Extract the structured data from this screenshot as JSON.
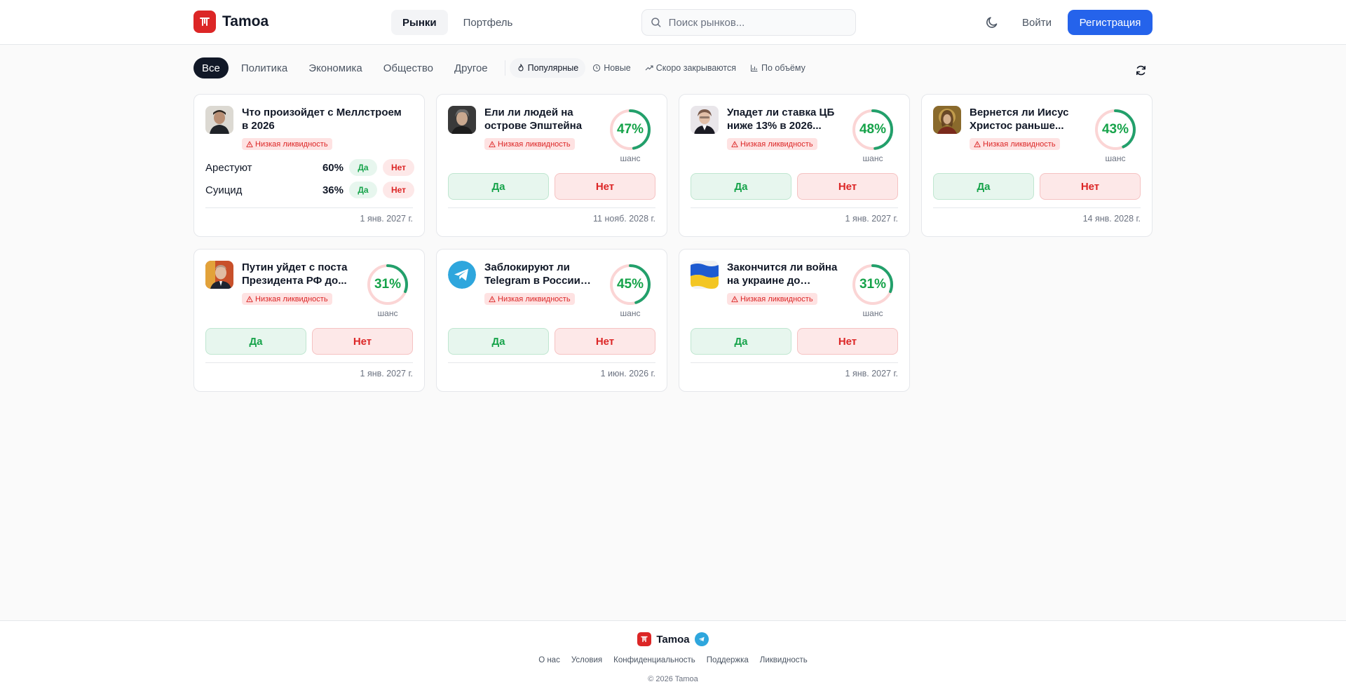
{
  "brand": {
    "name": "Tamoa"
  },
  "nav": {
    "markets": "Рынки",
    "portfolio": "Портфель"
  },
  "search": {
    "placeholder": "Поиск рынков..."
  },
  "auth": {
    "login": "Войти",
    "register": "Регистрация"
  },
  "categories": [
    "Все",
    "Политика",
    "Экономика",
    "Общество",
    "Другое"
  ],
  "sorts": [
    "Популярные",
    "Новые",
    "Скоро закрываются",
    "По объёму"
  ],
  "common": {
    "liquidity": "Низкая ликвидность",
    "chance": "шанс",
    "yes": "Да",
    "no": "Нет"
  },
  "colors": {
    "accent": "#2563eb",
    "brand": "#dc2626",
    "yes": "#16a34a",
    "no": "#dc2626"
  },
  "cards": [
    {
      "title": "Что произойдет с Меллстроем в 2026",
      "date": "1 янв. 2027 г.",
      "options": [
        {
          "name": "Арестуют",
          "pct": "60%"
        },
        {
          "name": "Суицид",
          "pct": "36%"
        }
      ]
    },
    {
      "title": "Ели ли людей на острове Эпштейна",
      "pct": "47%",
      "value": 47,
      "date": "11 нояб. 2028 г."
    },
    {
      "title": "Упадет ли ставка ЦБ ниже 13% в 2026...",
      "pct": "48%",
      "value": 48,
      "date": "1 янв. 2027 г."
    },
    {
      "title": "Вернется ли Иисус Христос раньше...",
      "pct": "43%",
      "value": 43,
      "date": "14 янв. 2028 г."
    },
    {
      "title": "Путин уйдет с поста Президента РФ до...",
      "pct": "31%",
      "value": 31,
      "date": "1 янв. 2027 г."
    },
    {
      "title": "Заблокируют ли Telegram в России д...",
      "pct": "45%",
      "value": 45,
      "date": "1 июн. 2026 г."
    },
    {
      "title": "Закончится ли война на украине до конца...",
      "pct": "31%",
      "value": 31,
      "date": "1 янв. 2027 г."
    }
  ],
  "footer": {
    "name": "Tamoa",
    "links": [
      "О нас",
      "Условия",
      "Конфиденциальность",
      "Поддержка",
      "Ликвидность"
    ],
    "copyright": "© 2026 Tamoa"
  }
}
